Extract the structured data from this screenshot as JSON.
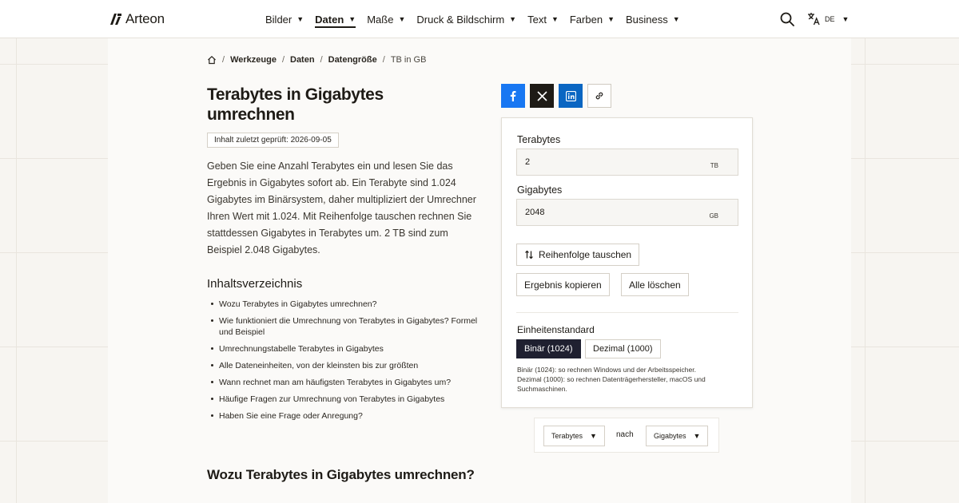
{
  "header": {
    "logo_text": "Arteon",
    "nav": [
      {
        "label": "Bilder",
        "caret": "▼",
        "active": false
      },
      {
        "label": "Daten",
        "caret": "▼",
        "active": true
      },
      {
        "label": "Maße",
        "caret": "▼",
        "active": false
      },
      {
        "label": "Druck & Bildschirm",
        "caret": "▼",
        "active": false
      },
      {
        "label": "Text",
        "caret": "▼",
        "active": false
      },
      {
        "label": "Farben",
        "caret": "▼",
        "active": false
      },
      {
        "label": "Business",
        "caret": "▼",
        "active": false
      }
    ],
    "search_icon": "search-icon",
    "language_icon": "translate-icon",
    "language_code": "DE",
    "language_caret": "▼"
  },
  "breadcrumb": {
    "home_icon": "home-icon",
    "separator": "/",
    "items": [
      "Werkzeuge",
      "Daten",
      "Datengröße"
    ],
    "current": "TB in GB"
  },
  "article": {
    "title": "Terabytes in Gigabytes umrechnen",
    "review_badge": "Inhalt zuletzt geprüft: 2026-09-05",
    "intro": "Geben Sie eine Anzahl Terabytes ein und lesen Sie das Ergebnis in Gigabytes sofort ab. Ein Terabyte sind 1.024 Gigabytes im Binärsystem, daher multipliziert der Umrechner Ihren Wert mit 1.024. Mit Reihenfolge tauschen rechnen Sie stattdessen Gigabytes in Terabytes um. 2 TB sind zum Beispiel 2.048 Gigabytes.",
    "toc_title": "Inhaltsverzeichnis",
    "toc": [
      "Wozu Terabytes in Gigabytes umrechnen?",
      "Wie funktioniert die Umrechnung von Terabytes in Gigabytes? Formel und Beispiel",
      "Umrechnungstabelle Terabytes in Gigabytes",
      "Alle Dateneinheiten, von der kleinsten bis zur größten",
      "Wann rechnet man am häufigsten Terabytes in Gigabytes um?",
      "Häufige Fragen zur Umrechnung von Terabytes in Gigabytes",
      "Haben Sie eine Frage oder Anregung?"
    ],
    "section_title": "Wozu Terabytes in Gigabytes umrechnen?"
  },
  "share": {
    "icons": [
      "facebook-icon",
      "x-icon",
      "linkedin-icon",
      "link-icon"
    ]
  },
  "converter": {
    "input_label": "Terabytes",
    "input_value": "2",
    "input_unit": "TB",
    "output_label": "Gigabytes",
    "output_value": "2048",
    "output_unit": "GB",
    "swap_label": "Reihenfolge tauschen",
    "copy_label": "Ergebnis kopieren",
    "clear_label": "Alle löschen",
    "standard_label": "Einheitenstandard",
    "binary_label": "Binär (1024)",
    "decimal_label": "Dezimal (1000)",
    "note_line1": "Binär (1024): so rechnen Windows und der Arbeitsspeicher.",
    "note_line2": "Dezimal (1000): so rechnen Datenträgerhersteller, macOS und Suchmaschinen."
  },
  "unit_picker": {
    "from": "Terabytes",
    "connector": "nach",
    "to": "Gigabytes",
    "caret": "▼"
  },
  "colors": {
    "facebook": "#1877f2",
    "x": "#1e1b16",
    "linkedin": "#0a66c2",
    "active_segment": "#1f2030"
  }
}
